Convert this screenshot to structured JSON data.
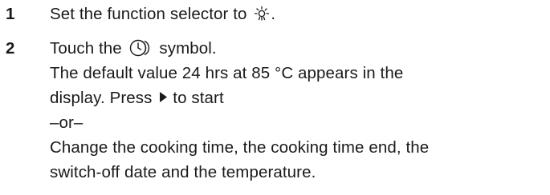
{
  "steps": [
    {
      "number": "1",
      "text_before_icon": "Set the function selector to",
      "icon": "light-bulb-icon",
      "text_after_icon": "."
    },
    {
      "number": "2",
      "text_before_icon": "Touch the",
      "icon": "timer-symbol-icon",
      "text_after_icon": "symbol.",
      "line2": "The default value 24 hrs at 85 °C appears in the",
      "line3_before_icon": "display. Press",
      "line3_icon": "play-arrow-icon",
      "line3_after_icon": "to start",
      "or_text": "–or–",
      "line5": "Change the cooking time, the cooking time end, the",
      "line6": "switch-off date and the temperature."
    }
  ]
}
